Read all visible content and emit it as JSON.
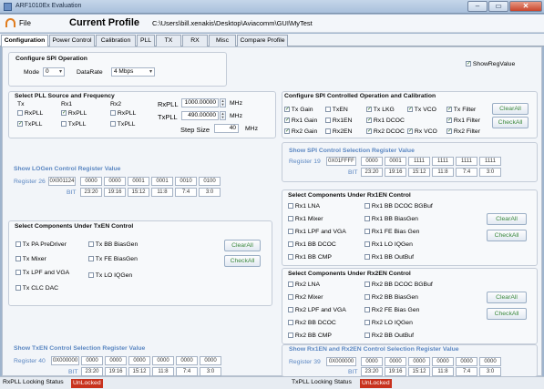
{
  "window": {
    "title": "ARF1010Ex Evaluation"
  },
  "menu": {
    "file": "File",
    "heading": "Current Profile",
    "path": "C:\\Users\\bill.xenakis\\Desktop\\Aviacomm\\GUI\\MyTest"
  },
  "tabs": [
    "Configuration",
    "Power Control",
    "Calibration",
    "PLL",
    "TX",
    "RX",
    "Misc",
    "Compare Profile"
  ],
  "spi_op": {
    "title": "Configure SPI Operation",
    "mode_label": "Mode",
    "mode_value": "0",
    "rate_label": "DataRate",
    "rate_value": "4 Mbps",
    "show_reg": "ShowRegValue"
  },
  "pll": {
    "title": "Select PLL Source and Frequency",
    "col_tx": "Tx",
    "col_rx1": "Rx1",
    "col_rx2": "Rx2",
    "rxpll": "RxPLL",
    "txpll": "TxPLL",
    "freq_rx_label": "RxPLL",
    "freq_rx_value": "1000.00000",
    "freq_tx_label": "TxPLL",
    "freq_tx_value": "490.00000",
    "mhz": "MHz",
    "step_label": "Step Size",
    "step_value": "40"
  },
  "logen": {
    "title": "Show LOGen Control Register Value",
    "reg_label": "Register 26",
    "reg_hex": "0X001124",
    "values": [
      "0000",
      "0000",
      "0001",
      "0001",
      "0010",
      "0100"
    ],
    "bit_label": "BIT",
    "bits": [
      "23:20",
      "19:16",
      "15:12",
      "11:8",
      "7:4",
      "3:0"
    ]
  },
  "txen": {
    "title": "Select Components Under TxEN Control",
    "items": [
      "Tx PA PreDriver",
      "Tx BB BiasGen",
      "Tx Mixer",
      "Tx FE BiasGen",
      "Tx LPF and VGA",
      "Tx LO IQGen",
      "Tx CLC DAC"
    ],
    "clear": "ClearAll",
    "check": "CheckAll"
  },
  "txen_reg": {
    "title": "Show TxEN Control Selection Register Value",
    "reg_label": "Register 40",
    "reg_hex": "0X000000",
    "values": [
      "0000",
      "0000",
      "0000",
      "0000",
      "0000",
      "0000"
    ],
    "bit_label": "BIT",
    "bits": [
      "23:20",
      "19:16",
      "15:12",
      "11:8",
      "7:4",
      "3:0"
    ]
  },
  "spi_ctrl": {
    "title": "Configure SPI Controlled Operation and  Calibration",
    "items": [
      {
        "label": "Tx Gain",
        "checked": true
      },
      {
        "label": "TxEN",
        "checked": false
      },
      {
        "label": "Tx LKG",
        "checked": true
      },
      {
        "label": "Tx VCO",
        "checked": true
      },
      {
        "label": "Tx Filter",
        "checked": true
      },
      {
        "label": "Rx1 Gain",
        "checked": true
      },
      {
        "label": "Rx1EN",
        "checked": false
      },
      {
        "label": "Rx1 DCOC",
        "checked": true
      },
      {
        "label": "",
        "checked": false
      },
      {
        "label": "Rx1 Filter",
        "checked": true
      },
      {
        "label": "Rx2 Gain",
        "checked": true
      },
      {
        "label": "Rx2EN",
        "checked": false
      },
      {
        "label": "Rx2 DCOC",
        "checked": true
      },
      {
        "label": "Rx VCO",
        "checked": true
      },
      {
        "label": "Rx2 Filter",
        "checked": true
      }
    ],
    "clear": "ClearAll",
    "check": "CheckAll"
  },
  "spi_reg": {
    "title": "Show SPI Control Selection Register Value",
    "reg_label": "Register 19",
    "reg_hex": "0X01FFFF",
    "values": [
      "0000",
      "0001",
      "1111",
      "1111",
      "1111",
      "1111"
    ],
    "bit_label": "BIT",
    "bits": [
      "23:20",
      "19:16",
      "15:12",
      "11:8",
      "7:4",
      "3:0"
    ]
  },
  "rx1en": {
    "title": "Select Components Under Rx1EN Control",
    "items": [
      "Rx1 LNA",
      "Rx1 BB DCOC BGBuf",
      "Rx1 Mixer",
      "Rx1 BB BiasGen",
      "Rx1 LPF and VGA",
      "Rx1 FE Bias Gen",
      "Rx1 BB DCOC",
      "Rx1 LO IQGen",
      "Rx1 BB CMP",
      "Rx1 BB OutBuf"
    ],
    "clear": "ClearAll",
    "check": "CheckAll"
  },
  "rx2en": {
    "title": "Select Components Under Rx2EN Control",
    "items": [
      "Rx2 LNA",
      "Rx2 BB DCOC BGBuf",
      "Rx2 Mixer",
      "Rx2 BB BiasGen",
      "Rx2 LPF and VGA",
      "Rx2 FE Bias Gen",
      "Rx2 BB DCOC",
      "Rx2 LO IQGen",
      "Rx2 BB CMP",
      "Rx2 BB OutBuf"
    ],
    "clear": "ClearAll",
    "check": "CheckAll"
  },
  "rxen_reg": {
    "title": "Show Rx1EN and Rx2EN Control Selection Register Value",
    "reg_label": "Register 39",
    "reg_hex": "0X000000",
    "values": [
      "0000",
      "0000",
      "0000",
      "0000",
      "0000",
      "0000"
    ],
    "bit_label": "BIT",
    "bits": [
      "23:20",
      "19:16",
      "15:12",
      "11:8",
      "7:4",
      "3:0"
    ]
  },
  "status": {
    "rx_label": "RxPLL Locking Status",
    "rx_state": "UnLocked",
    "tx_label": "TxPLL Locking Status",
    "tx_state": "UnLocked"
  },
  "colors": {
    "accent_blue": "#5b87c2",
    "unlocked_red": "#c8321e",
    "button_text_green": "#3c8a3c"
  }
}
